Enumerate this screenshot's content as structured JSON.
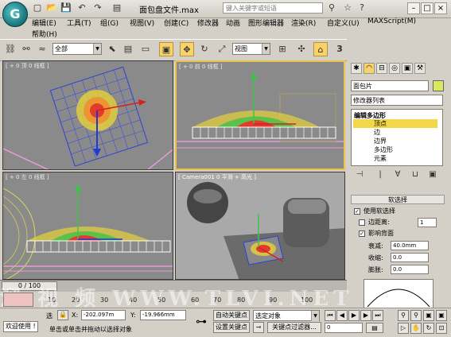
{
  "window": {
    "title": "面包盘文件.max",
    "search_placeholder": "键入关键字或短语",
    "logo_letter": "G"
  },
  "menu": [
    "编辑(E)",
    "工具(T)",
    "组(G)",
    "视图(V)",
    "创建(C)",
    "修改器",
    "动画",
    "图形编辑器",
    "渲染(R)",
    "自定义(U)",
    "MAXScript(M)",
    "帮助(H)"
  ],
  "toolbar": {
    "selection_filter": "全部",
    "reference_coord": "视图",
    "number_label": "3"
  },
  "viewports": {
    "top": "[ + 0 顶 0 线框 ]",
    "front": "[ + 0 前 0 线框 ]",
    "left": "[ + 0 左 0 线框 ]",
    "camera": "[ Camera001 0 平滑 + 高光 ]"
  },
  "command_panel": {
    "object_name": "面包片",
    "modifier_list": "修改器列表",
    "stack": [
      "编辑多边形",
      "顶点",
      "边",
      "边界",
      "多边形",
      "元素"
    ],
    "soft_selection_title": "软选择",
    "use_soft_selection": "使用软选择",
    "edge_distance": "边距离:",
    "edge_distance_value": "1",
    "affect_backfacing": "影响背面",
    "falloff_label": "衰减:",
    "falloff_value": "40.0mm",
    "pinch_label": "收缩:",
    "pinch_value": "0.0",
    "bubble_label": "膨胀:",
    "bubble_value": "0.0"
  },
  "timeline": {
    "frame_counter": "0 / 100",
    "ticks": [
      "0",
      "10",
      "20",
      "30",
      "40",
      "50",
      "60",
      "70",
      "80",
      "90",
      "100"
    ]
  },
  "status": {
    "welcome": "欢迎使用 !",
    "select_label": "选",
    "x_label": "X:",
    "x_value": "-202.097m",
    "y_label": "Y:",
    "y_value": "-19.966mm",
    "hint": "单击或单击并拖动以选择对象",
    "auto_key": "自动关键点",
    "set_key": "设置关键点",
    "selected_object": "选定对象",
    "key_filters": "关键点过滤器..."
  },
  "colors": {
    "active_viewport": "#e8c24a",
    "selection_blue": "#2b42d8",
    "stack_highlight": "#f3d74a"
  },
  "watermark": "溜 视 频 WWW.TLVI.NET"
}
